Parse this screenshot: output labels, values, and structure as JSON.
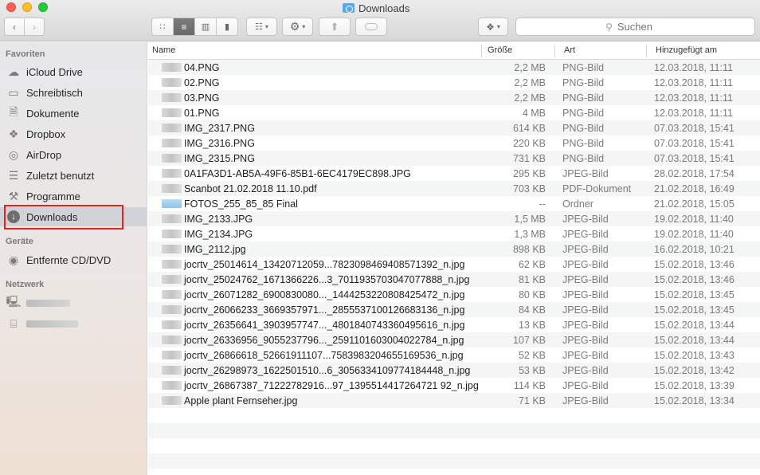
{
  "window": {
    "title": "Downloads"
  },
  "toolbar": {
    "back_icon": "chevron-left",
    "forward_icon": "chevron-right",
    "view_modes": [
      "icon-view",
      "list-view",
      "column-view",
      "gallery-view"
    ],
    "active_view": "list-view",
    "search_placeholder": "Suchen"
  },
  "sidebar": {
    "favorites_header": "Favoriten",
    "favorites": [
      {
        "label": "iCloud Drive",
        "icon": "cloud-icon"
      },
      {
        "label": "Schreibtisch",
        "icon": "desktop-icon"
      },
      {
        "label": "Dokumente",
        "icon": "document-icon"
      },
      {
        "label": "Dropbox",
        "icon": "dropbox-icon"
      },
      {
        "label": "AirDrop",
        "icon": "airdrop-icon"
      },
      {
        "label": "Zuletzt benutzt",
        "icon": "recents-icon"
      },
      {
        "label": "Programme",
        "icon": "applications-icon"
      },
      {
        "label": "Downloads",
        "icon": "downloads-icon",
        "selected": true
      }
    ],
    "devices_header": "Geräte",
    "devices": [
      {
        "label": "Entfernte CD/DVD",
        "icon": "disc-icon"
      }
    ],
    "network_header": "Netzwerk",
    "network_count": 2
  },
  "list": {
    "columns": {
      "name": "Name",
      "size": "Größe",
      "kind": "Art",
      "date": "Hinzugefügt am"
    },
    "rows": [
      {
        "name": "04.PNG",
        "size": "2,2 MB",
        "kind": "PNG-Bild",
        "date": "12.03.2018, 11:11"
      },
      {
        "name": "02.PNG",
        "size": "2,2 MB",
        "kind": "PNG-Bild",
        "date": "12.03.2018, 11:11"
      },
      {
        "name": "03.PNG",
        "size": "2,2 MB",
        "kind": "PNG-Bild",
        "date": "12.03.2018, 11:11"
      },
      {
        "name": "01.PNG",
        "size": "4 MB",
        "kind": "PNG-Bild",
        "date": "12.03.2018, 11:11"
      },
      {
        "name": "IMG_2317.PNG",
        "size": "614 KB",
        "kind": "PNG-Bild",
        "date": "07.03.2018, 15:41"
      },
      {
        "name": "IMG_2316.PNG",
        "size": "220 KB",
        "kind": "PNG-Bild",
        "date": "07.03.2018, 15:41"
      },
      {
        "name": "IMG_2315.PNG",
        "size": "731 KB",
        "kind": "PNG-Bild",
        "date": "07.03.2018, 15:41"
      },
      {
        "name": "0A1FA3D1-AB5A-49F6-85B1-6EC4179EC898.JPG",
        "size": "295 KB",
        "kind": "JPEG-Bild",
        "date": "28.02.2018, 17:54"
      },
      {
        "name": "Scanbot 21.02.2018 11.10.pdf",
        "size": "703 KB",
        "kind": "PDF-Dokument",
        "date": "21.02.2018, 16:49"
      },
      {
        "name": "FOTOS_255_85_85 Final",
        "size": "--",
        "kind": "Ordner",
        "date": "21.02.2018, 15:05",
        "folder": true
      },
      {
        "name": "IMG_2133.JPG",
        "size": "1,5 MB",
        "kind": "JPEG-Bild",
        "date": "19.02.2018, 11:40"
      },
      {
        "name": "IMG_2134.JPG",
        "size": "1,3 MB",
        "kind": "JPEG-Bild",
        "date": "19.02.2018, 11:40"
      },
      {
        "name": "IMG_2112.jpg",
        "size": "898 KB",
        "kind": "JPEG-Bild",
        "date": "16.02.2018, 10:21"
      },
      {
        "name": "jocrtv_25014614_13420712059...7823098469408571392_n.jpg",
        "size": "62 KB",
        "kind": "JPEG-Bild",
        "date": "15.02.2018, 13:46"
      },
      {
        "name": "jocrtv_25024762_1671366226...3_7011935703047077888_n.jpg",
        "size": "81 KB",
        "kind": "JPEG-Bild",
        "date": "15.02.2018, 13:46"
      },
      {
        "name": "jocrtv_26071282_6900830080..._1444253220808425472_n.jpg",
        "size": "80 KB",
        "kind": "JPEG-Bild",
        "date": "15.02.2018, 13:45"
      },
      {
        "name": "jocrtv_26066233_3669357971..._2855537100126683136_n.jpg",
        "size": "84 KB",
        "kind": "JPEG-Bild",
        "date": "15.02.2018, 13:45"
      },
      {
        "name": "jocrtv_26356641_3903957747..._4801840743360495616_n.jpg",
        "size": "13 KB",
        "kind": "JPEG-Bild",
        "date": "15.02.2018, 13:44"
      },
      {
        "name": "jocrtv_26336956_9055237796..._2591101603004022784_n.jpg",
        "size": "107 KB",
        "kind": "JPEG-Bild",
        "date": "15.02.2018, 13:44"
      },
      {
        "name": "jocrtv_26866618_52661911107...7583983204655169536_n.jpg",
        "size": "52 KB",
        "kind": "JPEG-Bild",
        "date": "15.02.2018, 13:43"
      },
      {
        "name": "jocrtv_26298973_1622501510...6_3056334109774184448_n.jpg",
        "size": "53 KB",
        "kind": "JPEG-Bild",
        "date": "15.02.2018, 13:42"
      },
      {
        "name": "jocrtv_26867387_71222782916...97_1395514417264721 92_n.jpg",
        "size": "114 KB",
        "kind": "JPEG-Bild",
        "date": "15.02.2018, 13:39"
      },
      {
        "name": "Apple plant Fernseher.jpg",
        "size": "71 KB",
        "kind": "JPEG-Bild",
        "date": "15.02.2018, 13:34"
      }
    ],
    "empty_rows": 5
  }
}
